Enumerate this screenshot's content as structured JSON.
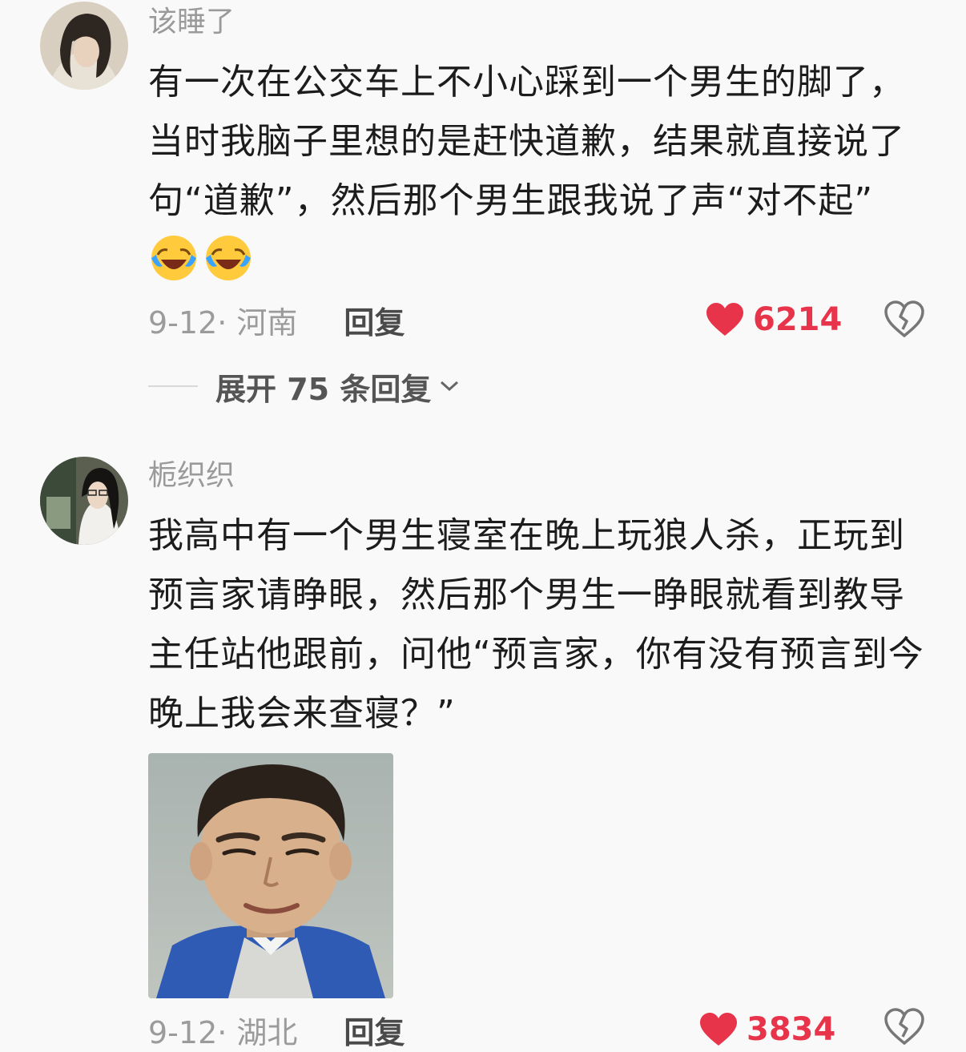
{
  "comments": [
    {
      "username": "该睡了",
      "text_lines": [
        "有一次在公交车上不小心踩到一个男生的脚了，",
        "当时我脑子里想的是赶快道歉，结果就直接说了",
        "句“道歉”，然后那个男生跟我说了声“对不起”"
      ],
      "emojis": [
        "laughing-crying-emoji",
        "laughing-crying-emoji"
      ],
      "meta": "9-12· 河南",
      "reply_label": "回复",
      "likes": "6214",
      "expand_label": "展开 75 条回复"
    },
    {
      "username": "栀织织",
      "text_lines": [
        "我高中有一个男生寝室在晚上玩狼人杀，正玩到",
        "预言家请睁眼，然后那个男生一睁眼就看到教导",
        "主任站他跟前，问他“预言家，你有没有预言到今",
        "晚上我会来查寝？”"
      ],
      "image": "boy-portrait-photo",
      "meta": "9-12· 湖北",
      "reply_label": "回复",
      "likes": "3834"
    }
  ],
  "icons": {
    "like": "heart-icon",
    "dislike": "broken-heart-icon",
    "expand": "chevron-down-icon"
  },
  "colors": {
    "like": "#e8344a",
    "meta": "#9b9b9b",
    "username": "#9a9a9a",
    "background": "#f9f9f9"
  }
}
